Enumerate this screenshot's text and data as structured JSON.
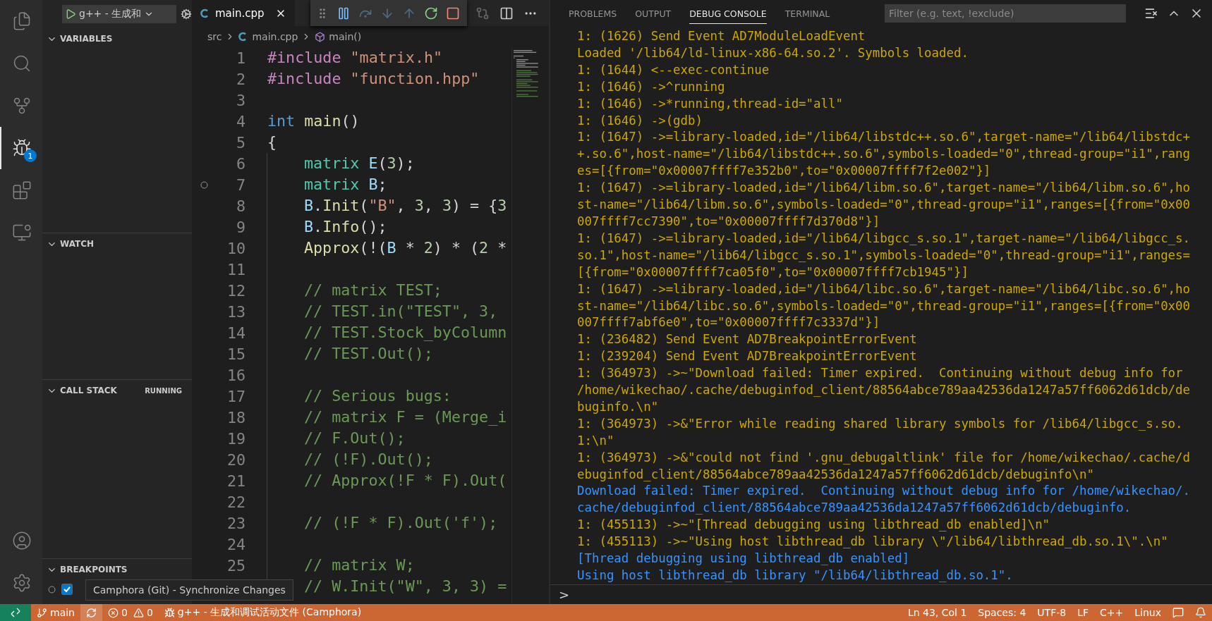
{
  "activity_bar": {
    "items": [
      {
        "selected": false
      },
      {
        "selected": false
      },
      {
        "selected": false
      },
      {
        "selected": true,
        "badge": "1"
      },
      {
        "selected": false
      },
      {
        "selected": false
      }
    ]
  },
  "sidebar": {
    "launch_config": "g++ - 生成和",
    "sections": [
      {
        "title": "VARIABLES",
        "expanded": true
      },
      {
        "title": "WATCH",
        "expanded": true
      },
      {
        "title": "CALL STACK",
        "expanded": true,
        "status": "RUNNING"
      },
      {
        "title": "BREAKPOINTS",
        "expanded": true
      }
    ],
    "breakpoint_checked": true
  },
  "editor": {
    "tabs": [
      {
        "label": "main.cpp",
        "selected": true
      }
    ],
    "debug_toolbar": [
      {
        "disabled": false
      },
      {
        "disabled": true
      },
      {
        "disabled": true
      },
      {
        "disabled": true
      },
      {
        "disabled": false
      },
      {
        "disabled": false
      }
    ],
    "breadcrumbs": [
      "src",
      "main.cpp",
      "main()"
    ],
    "lines": [
      {
        "n": "1",
        "indent": false,
        "breakpoint": false,
        "tokens": [
          {
            "kind": "pre",
            "text": "#include "
          },
          {
            "kind": "str",
            "text": "\"matrix.h\""
          }
        ]
      },
      {
        "n": "2",
        "indent": false,
        "breakpoint": false,
        "tokens": [
          {
            "kind": "pre",
            "text": "#include "
          },
          {
            "kind": "str",
            "text": "\"function.hpp\""
          }
        ]
      },
      {
        "n": "3",
        "indent": false,
        "breakpoint": false
      },
      {
        "n": "4",
        "indent": false,
        "breakpoint": false,
        "tokens": [
          {
            "kind": "kw",
            "text": "int "
          },
          {
            "kind": "fn",
            "text": "main"
          },
          {
            "kind": "plain",
            "text": "()"
          }
        ]
      },
      {
        "n": "5",
        "indent": false,
        "breakpoint": false,
        "tokens": [
          {
            "kind": "plain",
            "text": "{"
          }
        ]
      },
      {
        "n": "6",
        "indent": true,
        "breakpoint": false,
        "tokens": [
          {
            "kind": "type",
            "text": "matrix "
          },
          {
            "kind": "var",
            "text": "E"
          },
          {
            "kind": "plain",
            "text": "("
          },
          {
            "kind": "num",
            "text": "3"
          },
          {
            "kind": "plain",
            "text": ");"
          }
        ]
      },
      {
        "n": "7",
        "indent": true,
        "breakpoint": true,
        "tokens": [
          {
            "kind": "type",
            "text": "matrix "
          },
          {
            "kind": "var",
            "text": "B"
          },
          {
            "kind": "plain",
            "text": ";"
          }
        ]
      },
      {
        "n": "8",
        "indent": true,
        "breakpoint": false,
        "tokens": [
          {
            "kind": "var",
            "text": "B"
          },
          {
            "kind": "plain",
            "text": "."
          },
          {
            "kind": "fn",
            "text": "Init"
          },
          {
            "kind": "plain",
            "text": "("
          },
          {
            "kind": "str",
            "text": "\"B\""
          },
          {
            "kind": "plain",
            "text": ", "
          },
          {
            "kind": "num",
            "text": "3"
          },
          {
            "kind": "plain",
            "text": ", "
          },
          {
            "kind": "num",
            "text": "3"
          },
          {
            "kind": "plain",
            "text": ") = {"
          },
          {
            "kind": "num",
            "text": "3"
          }
        ]
      },
      {
        "n": "9",
        "indent": true,
        "breakpoint": false,
        "tokens": [
          {
            "kind": "var",
            "text": "B"
          },
          {
            "kind": "plain",
            "text": "."
          },
          {
            "kind": "fn",
            "text": "Info"
          },
          {
            "kind": "plain",
            "text": "();"
          }
        ]
      },
      {
        "n": "10",
        "indent": true,
        "breakpoint": false,
        "tokens": [
          {
            "kind": "fn",
            "text": "Approx"
          },
          {
            "kind": "plain",
            "text": "(!("
          },
          {
            "kind": "var",
            "text": "B"
          },
          {
            "kind": "plain",
            "text": " * "
          },
          {
            "kind": "num",
            "text": "2"
          },
          {
            "kind": "plain",
            "text": ") * ("
          },
          {
            "kind": "num",
            "text": "2"
          },
          {
            "kind": "plain",
            "text": " *"
          }
        ]
      },
      {
        "n": "11",
        "indent": true,
        "breakpoint": false
      },
      {
        "n": "12",
        "indent": true,
        "breakpoint": false,
        "tokens": [
          {
            "kind": "cmt",
            "text": "// matrix TEST;"
          }
        ]
      },
      {
        "n": "13",
        "indent": true,
        "breakpoint": false,
        "tokens": [
          {
            "kind": "cmt",
            "text": "// TEST.in(\"TEST\", 3,"
          }
        ]
      },
      {
        "n": "14",
        "indent": true,
        "breakpoint": false,
        "tokens": [
          {
            "kind": "cmt",
            "text": "// TEST.Stock_byColumn"
          }
        ]
      },
      {
        "n": "15",
        "indent": true,
        "breakpoint": false,
        "tokens": [
          {
            "kind": "cmt",
            "text": "// TEST.Out();"
          }
        ]
      },
      {
        "n": "16",
        "indent": true,
        "breakpoint": false
      },
      {
        "n": "17",
        "indent": true,
        "breakpoint": false,
        "tokens": [
          {
            "kind": "cmt",
            "text": "// Serious bugs:"
          }
        ]
      },
      {
        "n": "18",
        "indent": true,
        "breakpoint": false,
        "tokens": [
          {
            "kind": "cmt",
            "text": "// matrix F = (Merge_i"
          }
        ]
      },
      {
        "n": "19",
        "indent": true,
        "breakpoint": false,
        "tokens": [
          {
            "kind": "cmt",
            "text": "// F.Out();"
          }
        ]
      },
      {
        "n": "20",
        "indent": true,
        "breakpoint": false,
        "tokens": [
          {
            "kind": "cmt",
            "text": "// (!F).Out();"
          }
        ]
      },
      {
        "n": "21",
        "indent": true,
        "breakpoint": false,
        "tokens": [
          {
            "kind": "cmt",
            "text": "// Approx(!F * F).Out("
          }
        ]
      },
      {
        "n": "22",
        "indent": true,
        "breakpoint": false
      },
      {
        "n": "23",
        "indent": true,
        "breakpoint": false,
        "tokens": [
          {
            "kind": "cmt",
            "text": "// (!F * F).Out('f');"
          }
        ]
      },
      {
        "n": "24",
        "indent": true,
        "breakpoint": false
      },
      {
        "n": "25",
        "indent": true,
        "breakpoint": false,
        "tokens": [
          {
            "kind": "cmt",
            "text": "// matrix W;"
          }
        ]
      },
      {
        "indent": true,
        "breakpoint": false,
        "tokens": [
          {
            "kind": "cmt",
            "text": "// W.Init(\"W\", 3, 3) ="
          }
        ]
      }
    ]
  },
  "panel": {
    "tabs": [
      {
        "label": "PROBLEMS",
        "selected": false
      },
      {
        "label": "OUTPUT",
        "selected": false
      },
      {
        "label": "DEBUG CONSOLE",
        "selected": true
      },
      {
        "label": "TERMINAL",
        "selected": false
      }
    ],
    "filter": {
      "placeholder": "Filter (e.g. text, !exclude)"
    },
    "console": [
      {
        "kind": "log",
        "text": "1: (1626) Send Event AD7ModuleLoadEvent"
      },
      {
        "kind": "log",
        "text": "Loaded '/lib64/ld-linux-x86-64.so.2'. Symbols loaded."
      },
      {
        "kind": "log",
        "text": "1: (1644) <--exec-continue"
      },
      {
        "kind": "log",
        "text": "1: (1646) ->^running"
      },
      {
        "kind": "log",
        "text": "1: (1646) ->*running,thread-id=\"all\""
      },
      {
        "kind": "log",
        "text": "1: (1646) ->(gdb)"
      },
      {
        "kind": "log",
        "text": "1: (1647) ->=library-loaded,id=\"/lib64/libstdc++.so.6\",target-name=\"/lib64/libstdc++.so.6\",host-name=\"/lib64/libstdc++.so.6\",symbols-loaded=\"0\",thread-group=\"i1\",ranges=[{from=\"0x00007ffff7e352b0\",to=\"0x00007ffff7f2e002\"}]"
      },
      {
        "kind": "log",
        "text": "1: (1647) ->=library-loaded,id=\"/lib64/libm.so.6\",target-name=\"/lib64/libm.so.6\",host-name=\"/lib64/libm.so.6\",symbols-loaded=\"0\",thread-group=\"i1\",ranges=[{from=\"0x00007ffff7cc7390\",to=\"0x00007ffff7d370d8\"}]"
      },
      {
        "kind": "log",
        "text": "1: (1647) ->=library-loaded,id=\"/lib64/libgcc_s.so.1\",target-name=\"/lib64/libgcc_s.so.1\",host-name=\"/lib64/libgcc_s.so.1\",symbols-loaded=\"0\",thread-group=\"i1\",ranges=[{from=\"0x00007ffff7ca05f0\",to=\"0x00007ffff7cb1945\"}]"
      },
      {
        "kind": "log",
        "text": "1: (1647) ->=library-loaded,id=\"/lib64/libc.so.6\",target-name=\"/lib64/libc.so.6\",host-name=\"/lib64/libc.so.6\",symbols-loaded=\"0\",thread-group=\"i1\",ranges=[{from=\"0x00007ffff7abf6e0\",to=\"0x00007ffff7c3337d\"}]"
      },
      {
        "kind": "log",
        "text": "1: (236482) Send Event AD7BreakpointErrorEvent"
      },
      {
        "kind": "log",
        "text": "1: (239204) Send Event AD7BreakpointErrorEvent"
      },
      {
        "kind": "log",
        "text": "1: (364973) ->~\"Download failed: Timer expired.  Continuing without debug info for /home/wikechao/.cache/debuginfod_client/88564abce789aa42536da1247a57ff6062d61dcb/debuginfo.\\n\""
      },
      {
        "kind": "log",
        "text": "1: (364973) ->&\"Error while reading shared library symbols for /lib64/libgcc_s.so.1:\\n\""
      },
      {
        "kind": "log",
        "text": "1: (364973) ->&\"could not find '.gnu_debugaltlink' file for /home/wikechao/.cache/debuginfod_client/88564abce789aa42536da1247a57ff6062d61dcb/debuginfo\\n\""
      },
      {
        "kind": "info",
        "text": "Download failed: Timer expired.  Continuing without debug info for /home/wikechao/.cache/debuginfod_client/88564abce789aa42536da1247a57ff6062d61dcb/debuginfo."
      },
      {
        "kind": "log",
        "text": "1: (455113) ->~\"[Thread debugging using libthread_db enabled]\\n\""
      },
      {
        "kind": "log",
        "text": "1: (455113) ->~\"Using host libthread_db library \\\"/lib64/libthread_db.so.1\\\".\\n\""
      },
      {
        "kind": "info",
        "text": "[Thread debugging using libthread_db enabled]"
      },
      {
        "kind": "info",
        "text": "Using host libthread_db library \"/lib64/libthread_db.so.1\"."
      }
    ],
    "prompt": ">"
  },
  "tooltip": "Camphora (Git) - Synchronize Changes",
  "status_bar": {
    "left": [
      {
        "kind": "branch",
        "text": "main"
      },
      {
        "kind": "sync",
        "highlighted": true
      },
      {
        "kind": "problems",
        "errors": "0",
        "warnings": "0"
      },
      {
        "kind": "debug",
        "text": "g++ - 生成和调试活动文件 (Camphora)"
      }
    ],
    "right": [
      {
        "kind": "text",
        "text": "Ln 43, Col 1"
      },
      {
        "kind": "text",
        "text": "Spaces: 4"
      },
      {
        "kind": "text",
        "text": "UTF-8"
      },
      {
        "kind": "text",
        "text": "LF"
      },
      {
        "kind": "text",
        "text": "C++"
      },
      {
        "kind": "text",
        "text": "Linux"
      },
      {
        "kind": "feedback"
      },
      {
        "kind": "bell"
      }
    ]
  }
}
